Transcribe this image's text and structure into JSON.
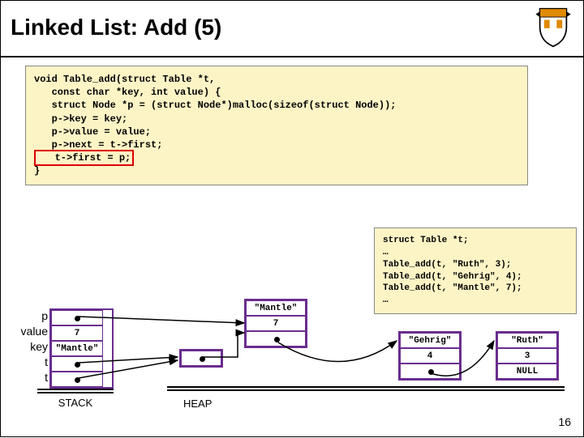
{
  "title": "Linked List: Add (5)",
  "code_main": {
    "l1": "void Table_add(struct Table *t,",
    "l2": "   const char *key, int value) {",
    "l3": "   struct Node *p = (struct Node*)malloc(sizeof(struct Node));",
    "l4": "   p->key = key;",
    "l5": "   p->value = value;",
    "l6": "   p->next = t->first;",
    "l7": "   t->first = p;",
    "l8": "}"
  },
  "code_caller": {
    "l1": "struct Table *t;",
    "l2": "…",
    "l3": "Table_add(t, \"Ruth\", 3);",
    "l4": "Table_add(t, \"Gehrig\", 4);",
    "l5": "Table_add(t, \"Mantle\", 7);",
    "l6": "…"
  },
  "stack": {
    "labels": {
      "p": "p",
      "value": "value",
      "key": "key",
      "t_inner": "t",
      "t_outer": "t"
    },
    "values": {
      "value": "7",
      "key": "\"Mantle\""
    },
    "caption": "STACK"
  },
  "heap": {
    "caption": "HEAP",
    "table_box": {},
    "mantle": {
      "key": "\"Mantle\"",
      "value": "7"
    },
    "gehrig": {
      "key": "\"Gehrig\"",
      "value": "4"
    },
    "ruth": {
      "key": "\"Ruth\"",
      "value": "3",
      "next": "NULL"
    }
  },
  "page_number": "16"
}
